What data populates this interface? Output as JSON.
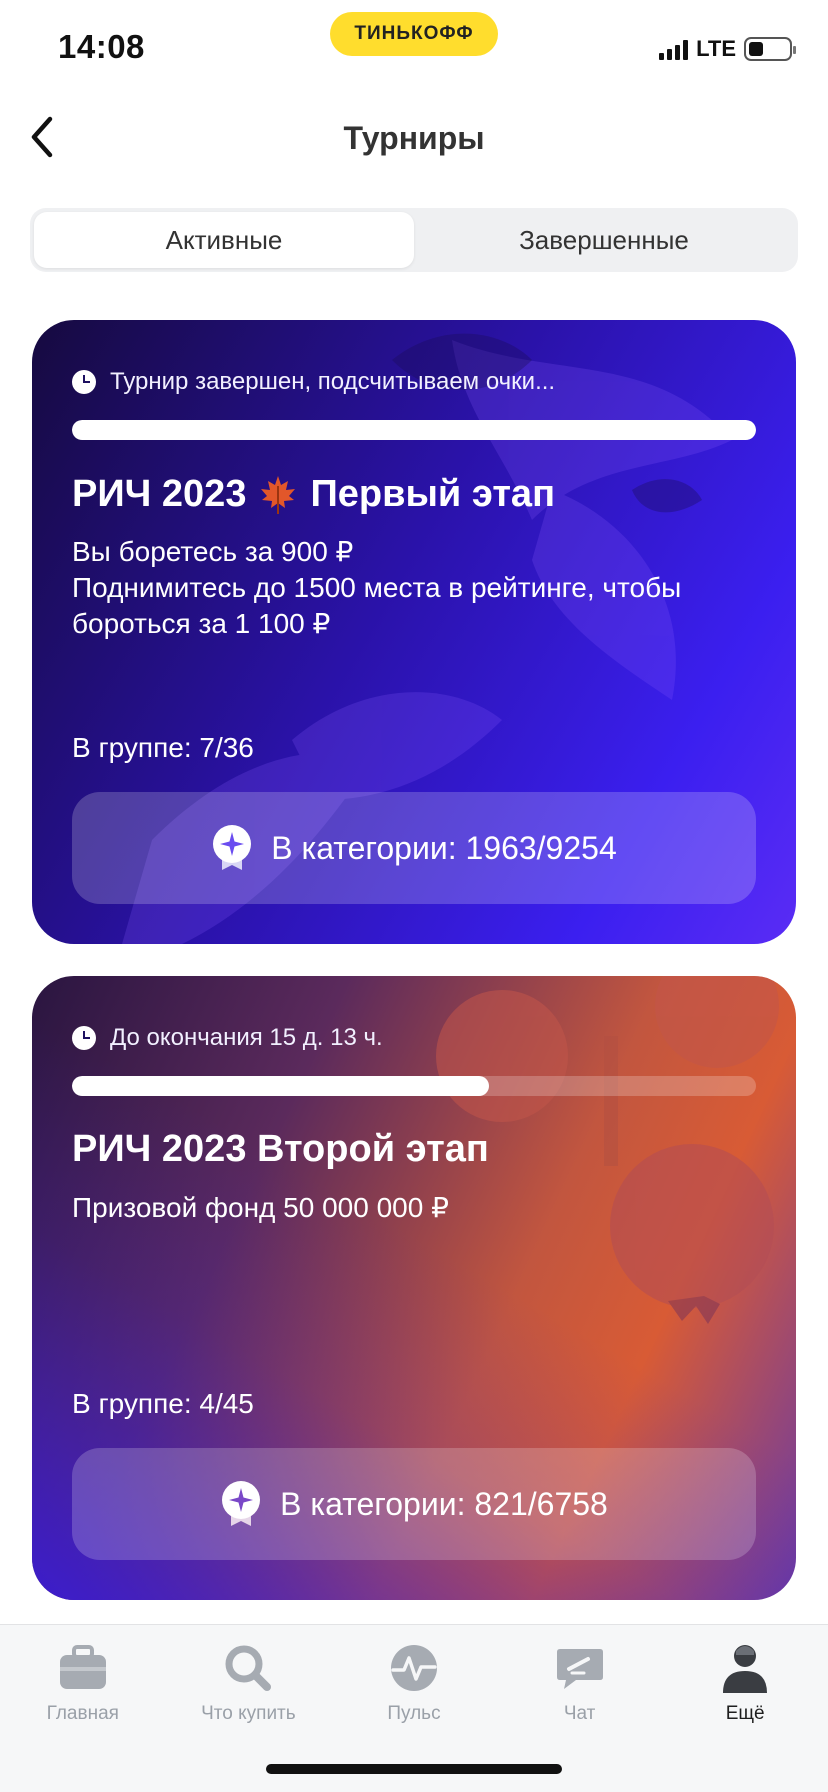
{
  "status_bar": {
    "time": "14:08",
    "brand": "ТИНЬКОФФ",
    "network": "LTE"
  },
  "header": {
    "title": "Турниры"
  },
  "tabs": [
    {
      "label": "Активные",
      "active": true
    },
    {
      "label": "Завершенные",
      "active": false
    }
  ],
  "cards": [
    {
      "status": "Турнир завершен, подсчитываем очки...",
      "progress": 1.0,
      "title": "РИЧ 2023",
      "title_emoji_icon": "maple-leaf-icon",
      "title_suffix": "Первый этап",
      "desc_line1": "Вы боретесь за 900 ₽",
      "desc_line2": "Поднимитесь до 1500 места в рейтинге, чтобы бороться за 1 100 ₽",
      "group": "В группе: 7/36",
      "category": "В категории: 1963/9254"
    },
    {
      "status": "До окончания 15 д. 13 ч.",
      "progress": 0.61,
      "title": "РИЧ 2023 Второй этап",
      "desc_line1": "Призовой фонд 50 000 000 ₽",
      "group": "В группе: 4/45",
      "category": "В категории: 821/6758"
    }
  ],
  "tab_bar": [
    {
      "label": "Главная",
      "icon": "briefcase-icon",
      "active": false
    },
    {
      "label": "Что купить",
      "icon": "search-icon",
      "active": false
    },
    {
      "label": "Пульс",
      "icon": "pulse-icon",
      "active": false
    },
    {
      "label": "Чат",
      "icon": "chat-icon",
      "active": false
    },
    {
      "label": "Ещё",
      "icon": "profile-icon",
      "active": true
    }
  ],
  "colors": {
    "brand_yellow": "#ffdd2d",
    "card1_accent": "#3b1ff0",
    "card2_accent": "#d85b35",
    "tab_inactive": "#9aa0a8"
  }
}
